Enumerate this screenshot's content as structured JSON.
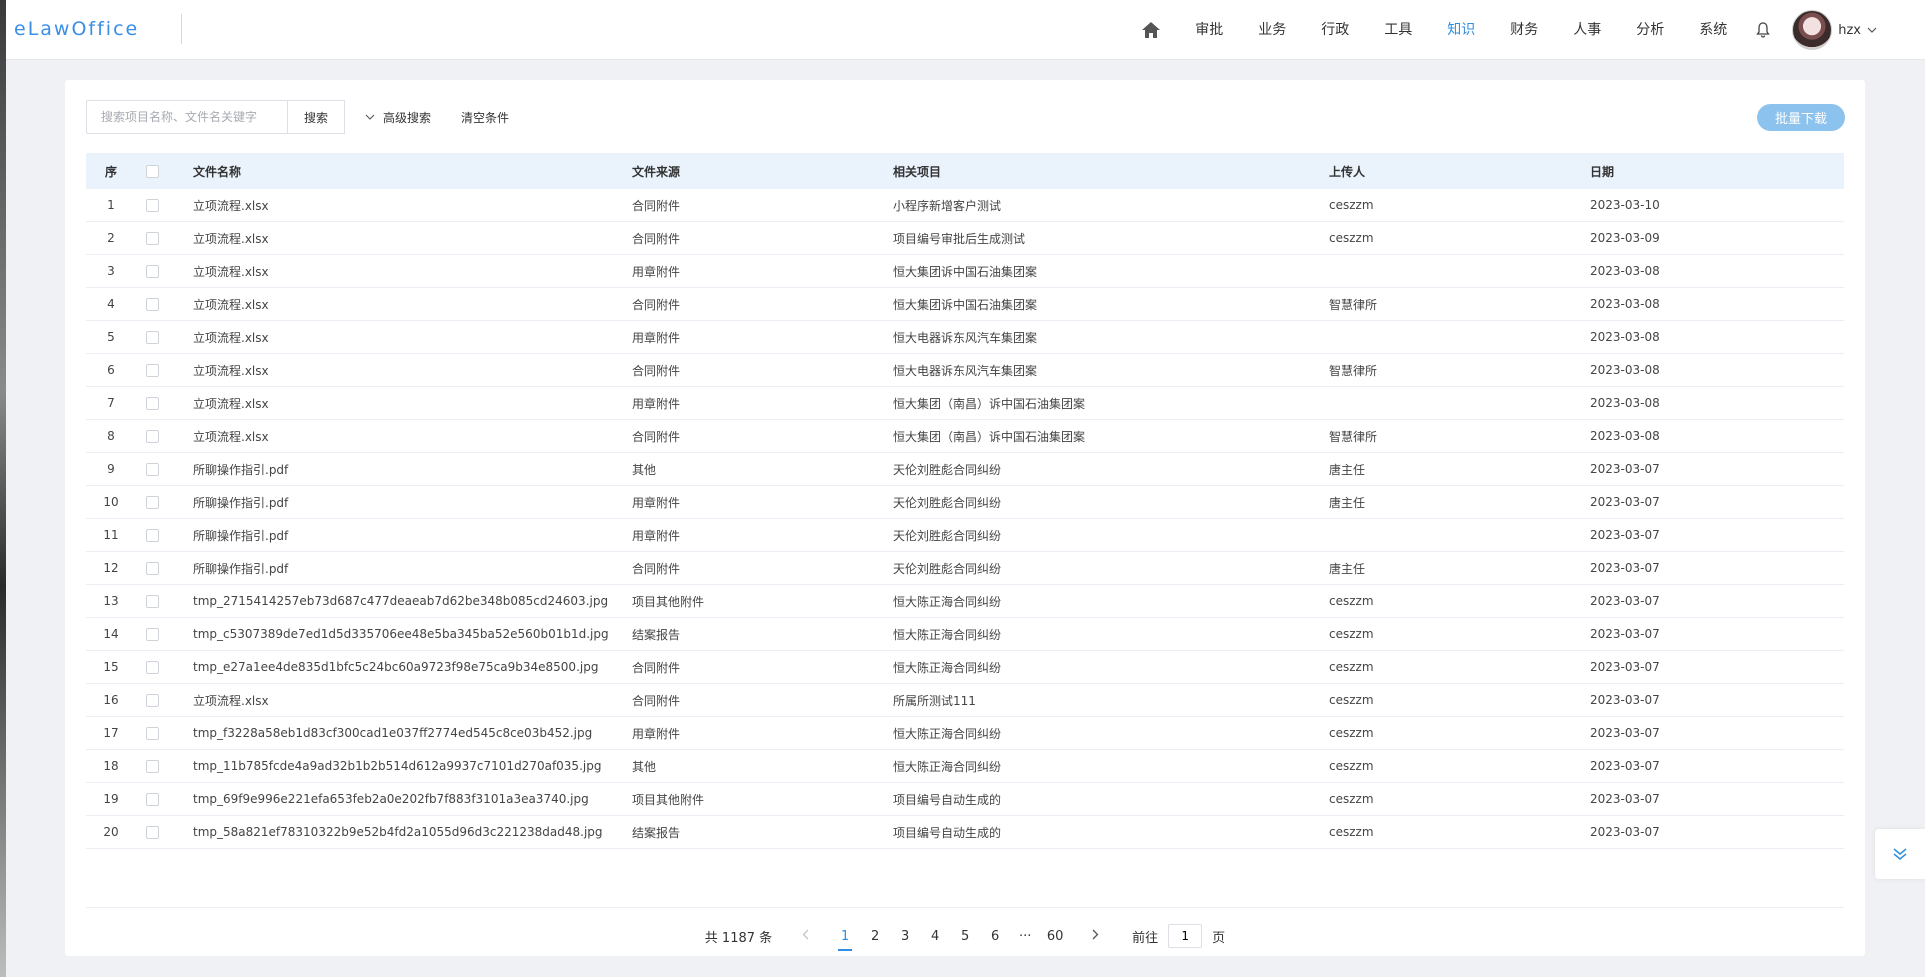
{
  "brand": {
    "logo_text": "eLawOffice"
  },
  "nav": {
    "items": [
      "审批",
      "业务",
      "行政",
      "工具",
      "知识",
      "财务",
      "人事",
      "分析",
      "系统"
    ],
    "active": "知识",
    "user_name": "hzx"
  },
  "toolbar": {
    "search_placeholder": "搜索项目名称、文件名关键字",
    "search_value": "",
    "search_button": "搜索",
    "advanced_search": "高级搜索",
    "clear_conditions": "清空条件",
    "batch_download": "批量下载"
  },
  "table": {
    "headers": [
      "序",
      "文件名称",
      "文件来源",
      "相关项目",
      "上传人",
      "日期"
    ],
    "rows": [
      {
        "idx": "1",
        "name": "立项流程.xlsx",
        "source": "合同附件",
        "project": "小程序新增客户测试",
        "uploader": "ceszzm",
        "date": "2023-03-10"
      },
      {
        "idx": "2",
        "name": "立项流程.xlsx",
        "source": "合同附件",
        "project": "项目编号审批后生成测试",
        "uploader": "ceszzm",
        "date": "2023-03-09"
      },
      {
        "idx": "3",
        "name": "立项流程.xlsx",
        "source": "用章附件",
        "project": "恒大集团诉中国石油集团案",
        "uploader": "",
        "date": "2023-03-08"
      },
      {
        "idx": "4",
        "name": "立项流程.xlsx",
        "source": "合同附件",
        "project": "恒大集团诉中国石油集团案",
        "uploader": "智慧律所",
        "date": "2023-03-08"
      },
      {
        "idx": "5",
        "name": "立项流程.xlsx",
        "source": "用章附件",
        "project": "恒大电器诉东风汽车集团案",
        "uploader": "",
        "date": "2023-03-08"
      },
      {
        "idx": "6",
        "name": "立项流程.xlsx",
        "source": "合同附件",
        "project": "恒大电器诉东风汽车集团案",
        "uploader": "智慧律所",
        "date": "2023-03-08"
      },
      {
        "idx": "7",
        "name": "立项流程.xlsx",
        "source": "用章附件",
        "project": "恒大集团（南昌）诉中国石油集团案",
        "uploader": "",
        "date": "2023-03-08"
      },
      {
        "idx": "8",
        "name": "立项流程.xlsx",
        "source": "合同附件",
        "project": "恒大集团（南昌）诉中国石油集团案",
        "uploader": "智慧律所",
        "date": "2023-03-08"
      },
      {
        "idx": "9",
        "name": "所聊操作指引.pdf",
        "source": "其他",
        "project": "天伦刘胜彪合同纠纷",
        "uploader": "唐主任",
        "date": "2023-03-07"
      },
      {
        "idx": "10",
        "name": "所聊操作指引.pdf",
        "source": "用章附件",
        "project": "天伦刘胜彪合同纠纷",
        "uploader": "唐主任",
        "date": "2023-03-07"
      },
      {
        "idx": "11",
        "name": "所聊操作指引.pdf",
        "source": "用章附件",
        "project": "天伦刘胜彪合同纠纷",
        "uploader": "",
        "date": "2023-03-07"
      },
      {
        "idx": "12",
        "name": "所聊操作指引.pdf",
        "source": "合同附件",
        "project": "天伦刘胜彪合同纠纷",
        "uploader": "唐主任",
        "date": "2023-03-07"
      },
      {
        "idx": "13",
        "name": "tmp_2715414257eb73d687c477deaeab7d62be348b085cd24603.jpg",
        "source": "项目其他附件",
        "project": "恒大陈正海合同纠纷",
        "uploader": "ceszzm",
        "date": "2023-03-07"
      },
      {
        "idx": "14",
        "name": "tmp_c5307389de7ed1d5d335706ee48e5ba345ba52e560b01b1d.jpg",
        "source": "结案报告",
        "project": "恒大陈正海合同纠纷",
        "uploader": "ceszzm",
        "date": "2023-03-07"
      },
      {
        "idx": "15",
        "name": "tmp_e27a1ee4de835d1bfc5c24bc60a9723f98e75ca9b34e8500.jpg",
        "source": "合同附件",
        "project": "恒大陈正海合同纠纷",
        "uploader": "ceszzm",
        "date": "2023-03-07"
      },
      {
        "idx": "16",
        "name": "立项流程.xlsx",
        "source": "合同附件",
        "project": "所属所测试111",
        "uploader": "ceszzm",
        "date": "2023-03-07"
      },
      {
        "idx": "17",
        "name": "tmp_f3228a58eb1d83cf300cad1e037ff2774ed545c8ce03b452.jpg",
        "source": "用章附件",
        "project": "恒大陈正海合同纠纷",
        "uploader": "ceszzm",
        "date": "2023-03-07"
      },
      {
        "idx": "18",
        "name": "tmp_11b785fcde4a9ad32b1b2b514d612a9937c7101d270af035.jpg",
        "source": "其他",
        "project": "恒大陈正海合同纠纷",
        "uploader": "ceszzm",
        "date": "2023-03-07"
      },
      {
        "idx": "19",
        "name": "tmp_69f9e996e221efa653feb2a0e202fb7f883f3101a3ea3740.jpg",
        "source": "项目其他附件",
        "project": "项目编号自动生成的",
        "uploader": "ceszzm",
        "date": "2023-03-07"
      },
      {
        "idx": "20",
        "name": "tmp_58a821ef78310322b9e52b4fd2a1055d96d3c221238dad48.jpg",
        "source": "结案报告",
        "project": "项目编号自动生成的",
        "uploader": "ceszzm",
        "date": "2023-03-07"
      }
    ]
  },
  "pagination": {
    "total_text": "共 1187 条",
    "pages": [
      "1",
      "2",
      "3",
      "4",
      "5",
      "6",
      "···",
      "60"
    ],
    "current": "1",
    "goto_label": "前往",
    "goto_value": "1",
    "goto_suffix": "页"
  },
  "colors": {
    "accent": "#2f8fe0",
    "batch_button": "#8cc2ee",
    "table_header_bg": "#eaf2fb"
  },
  "icons": [
    "home-icon",
    "bell-icon",
    "chevron-down-icon",
    "chevron-left-icon",
    "chevron-right-icon",
    "double-chevron-down-icon"
  ]
}
